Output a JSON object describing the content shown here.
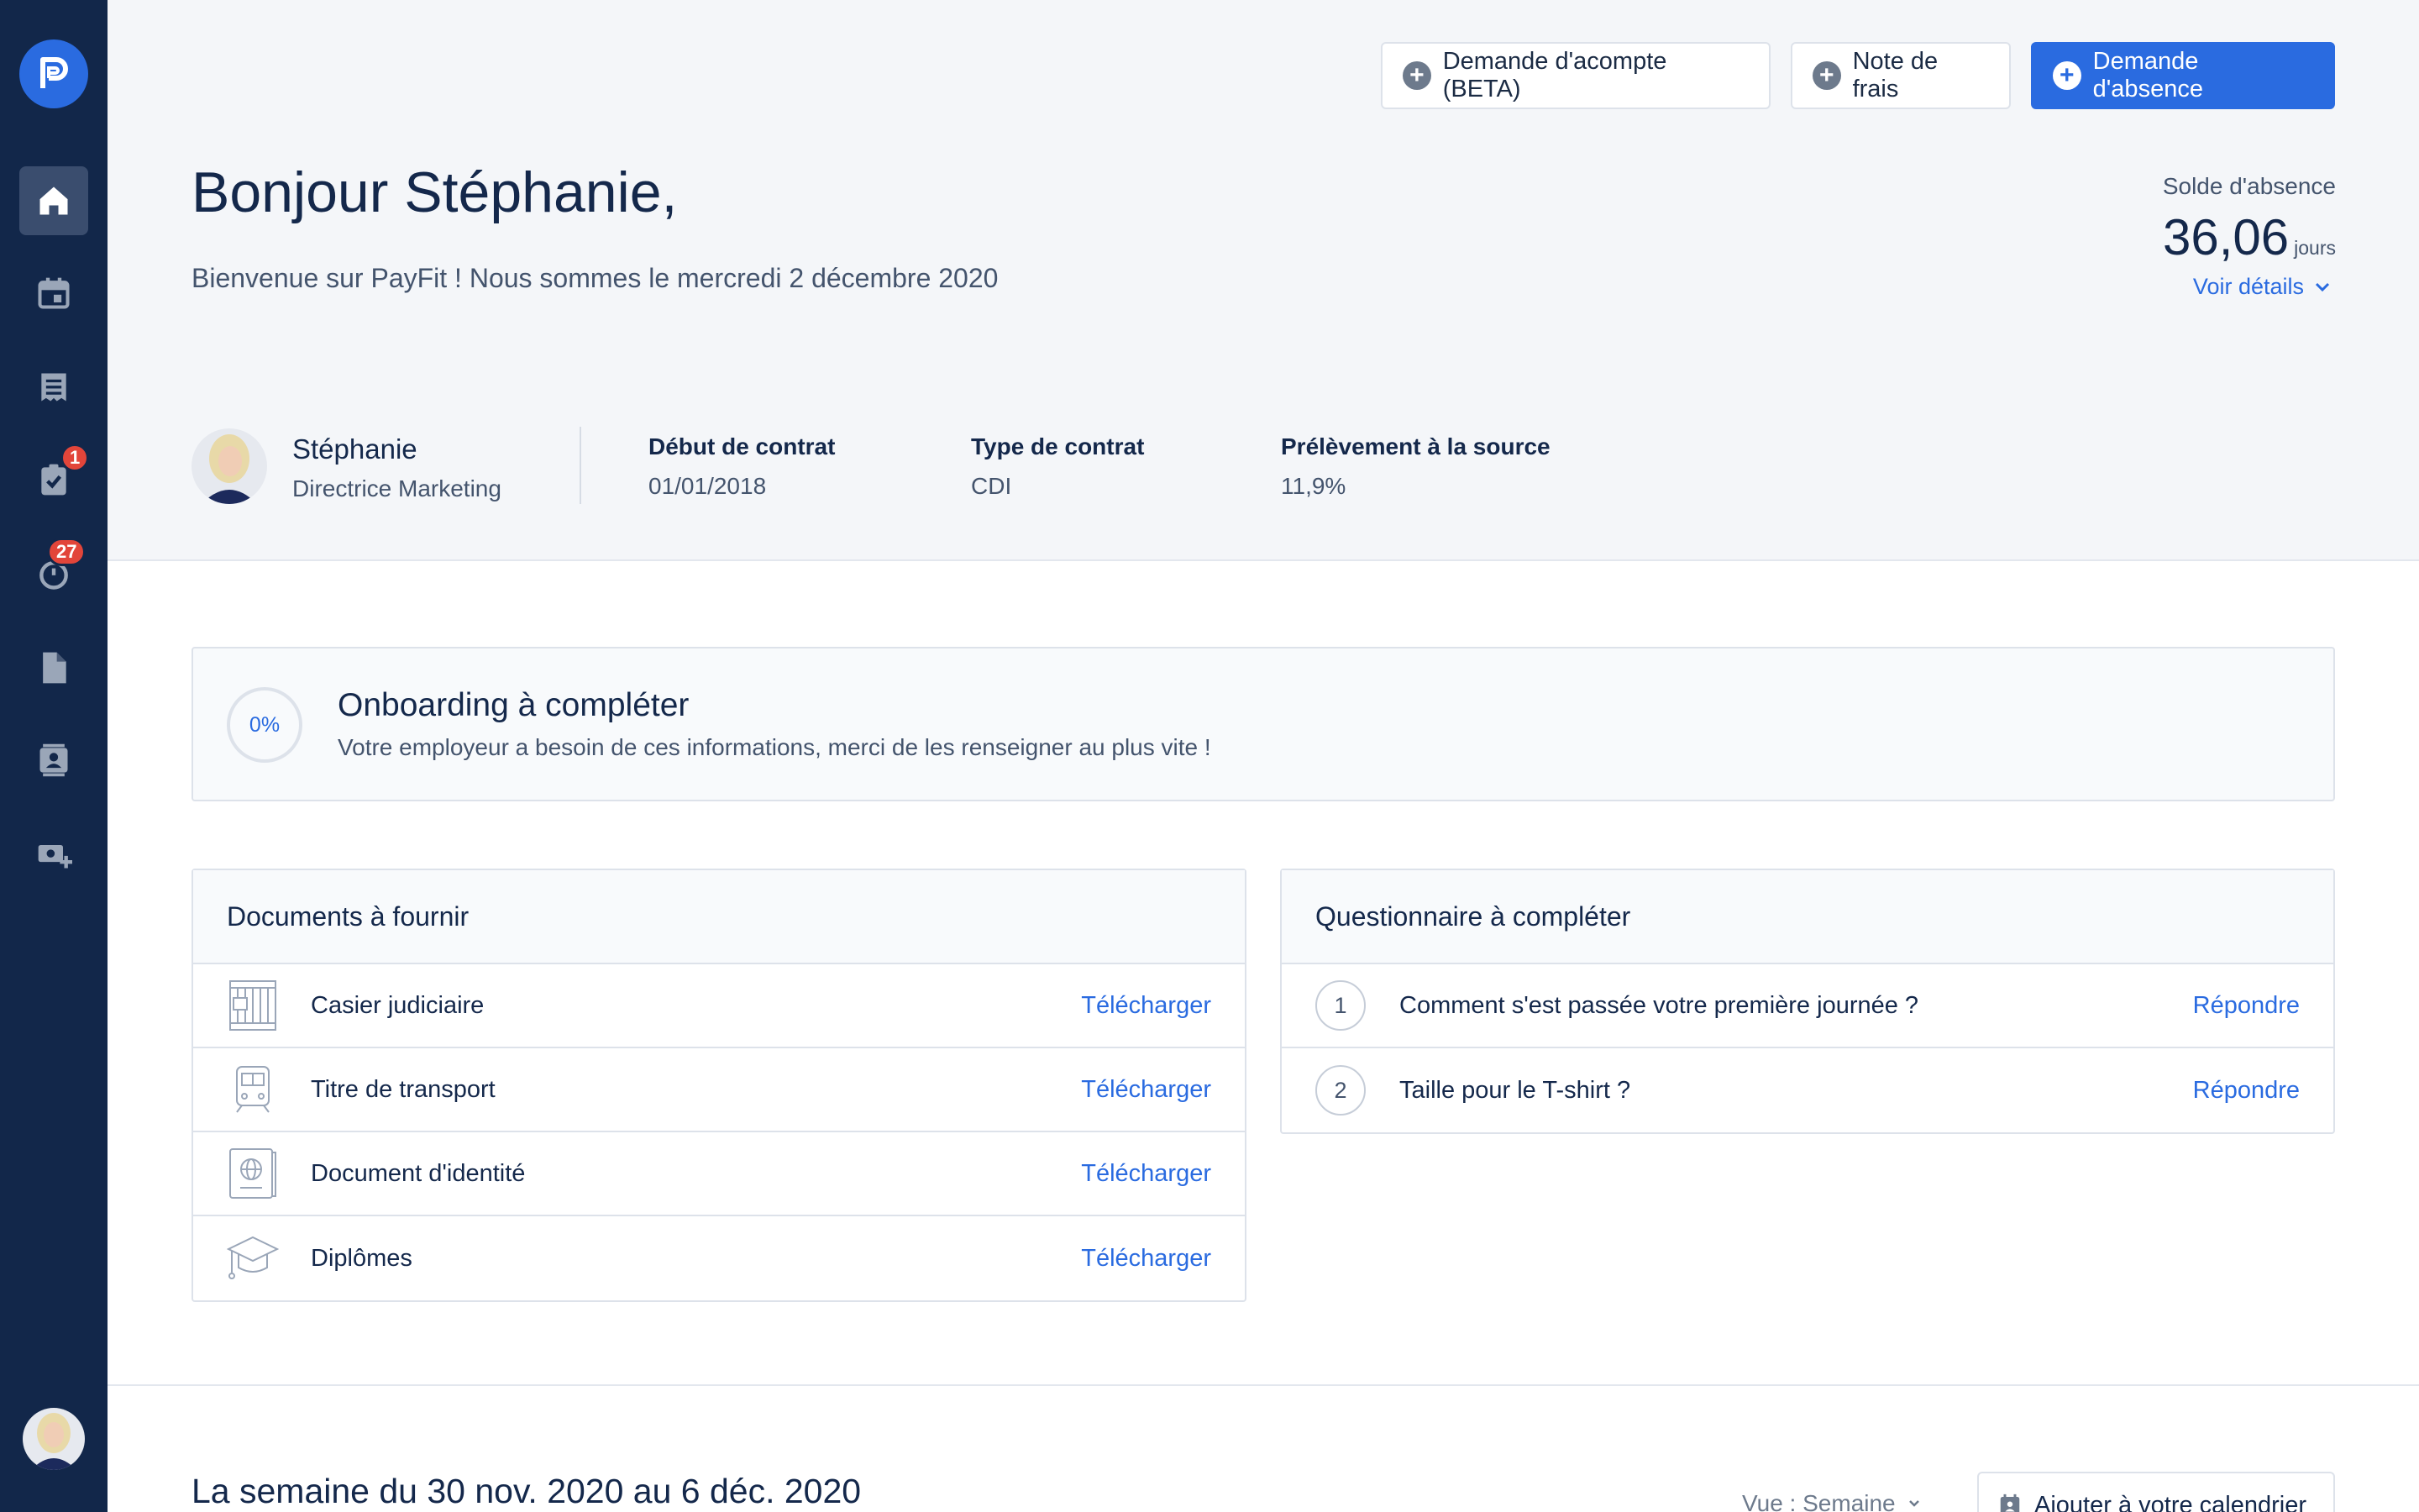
{
  "sidebar": {
    "nav": [
      {
        "name": "home",
        "active": true
      },
      {
        "name": "calendar",
        "active": false
      },
      {
        "name": "payslips",
        "active": false
      },
      {
        "name": "tasks",
        "badge": "1"
      },
      {
        "name": "time",
        "badge": "27"
      },
      {
        "name": "documents",
        "active": false
      },
      {
        "name": "directory",
        "active": false
      },
      {
        "name": "expenses",
        "active": false
      }
    ]
  },
  "header": {
    "buttons": {
      "advance": "Demande d'acompte (BETA)",
      "expense": "Note de frais",
      "absence": "Demande d'absence"
    },
    "greeting": "Bonjour Stéphanie,",
    "welcome": "Bienvenue sur PayFit ! Nous sommes le mercredi 2 décembre 2020",
    "balance": {
      "label": "Solde d'absence",
      "value": "36,06",
      "unit": "jours",
      "details": "Voir détails"
    }
  },
  "profile": {
    "name": "Stéphanie",
    "role": "Directrice Marketing",
    "contract_start_label": "Début de contrat",
    "contract_start": "01/01/2018",
    "contract_type_label": "Type de contrat",
    "contract_type": "CDI",
    "tax_label": "Prélèvement à la source",
    "tax": "11,9%"
  },
  "onboarding": {
    "progress": "0%",
    "title": "Onboarding à compléter",
    "subtitle": "Votre employeur a besoin de ces informations, merci de les renseigner au plus vite !"
  },
  "documents": {
    "title": "Documents à fournir",
    "items": [
      {
        "label": "Casier judiciaire",
        "action": "Télécharger"
      },
      {
        "label": "Titre de transport",
        "action": "Télécharger"
      },
      {
        "label": "Document d'identité",
        "action": "Télécharger"
      },
      {
        "label": "Diplômes",
        "action": "Télécharger"
      }
    ]
  },
  "questionnaire": {
    "title": "Questionnaire à compléter",
    "items": [
      {
        "num": "1",
        "label": "Comment s'est passée votre première journée ?",
        "action": "Répondre"
      },
      {
        "num": "2",
        "label": "Taille pour le T-shirt ?",
        "action": "Répondre"
      }
    ]
  },
  "week": {
    "title": "La semaine du 30 nov. 2020 au 6 déc. 2020",
    "view": "Vue : Semaine",
    "add_calendar": "Ajouter à votre calendrier"
  },
  "colors": {
    "sidebar": "#12274a",
    "accent": "#2a6be0",
    "badge": "#e2453a"
  }
}
